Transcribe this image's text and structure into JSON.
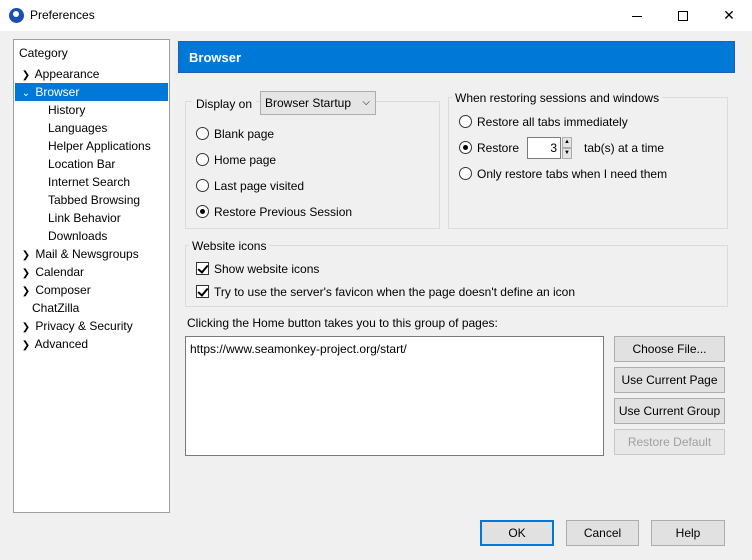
{
  "window": {
    "title": "Preferences",
    "minimize": "—",
    "maximize": "☐",
    "close": "✕"
  },
  "sidebar": {
    "header": "Category",
    "items": [
      {
        "label": "Appearance",
        "expandable": true
      },
      {
        "label": "Browser",
        "expandable": true,
        "expanded": true,
        "selected": true
      },
      {
        "label": "History"
      },
      {
        "label": "Languages"
      },
      {
        "label": "Helper Applications"
      },
      {
        "label": "Location Bar"
      },
      {
        "label": "Internet Search"
      },
      {
        "label": "Tabbed Browsing"
      },
      {
        "label": "Link Behavior"
      },
      {
        "label": "Downloads"
      },
      {
        "label": "Mail & Newsgroups",
        "expandable": true
      },
      {
        "label": "Calendar",
        "expandable": true
      },
      {
        "label": "Composer",
        "expandable": true
      },
      {
        "label": "ChatZilla"
      },
      {
        "label": "Privacy & Security",
        "expandable": true
      },
      {
        "label": "Advanced",
        "expandable": true
      }
    ]
  },
  "panel": {
    "title": "Browser",
    "display_on": {
      "label": "Display on",
      "selected": "Browser Startup",
      "options": [
        {
          "label": "Blank page",
          "checked": false
        },
        {
          "label": "Home page",
          "checked": false
        },
        {
          "label": "Last page visited",
          "checked": false
        },
        {
          "label": "Restore Previous Session",
          "checked": true
        }
      ]
    },
    "restore": {
      "label": "When restoring sessions and windows",
      "options": [
        {
          "label": "Restore all tabs immediately",
          "checked": false
        },
        {
          "label": "Restore",
          "checked": true
        },
        {
          "label": "Only restore tabs when I need them",
          "checked": false
        }
      ],
      "tab_count": "3",
      "tab_suffix": "tab(s) at a time"
    },
    "website_icons": {
      "label": "Website icons",
      "show_icons": {
        "label": "Show website icons",
        "checked": true
      },
      "try_favicon": {
        "label": "Try to use the server's favicon when the page doesn't define an icon",
        "checked": true
      }
    },
    "home": {
      "label": "Clicking the Home button takes you to this group of pages:",
      "url": "https://www.seamonkey-project.org/start/",
      "choose_file": "Choose File...",
      "use_current_page": "Use Current Page",
      "use_current_group": "Use Current Group",
      "restore_default": "Restore Default"
    }
  },
  "footer": {
    "ok": "OK",
    "cancel": "Cancel",
    "help": "Help"
  }
}
